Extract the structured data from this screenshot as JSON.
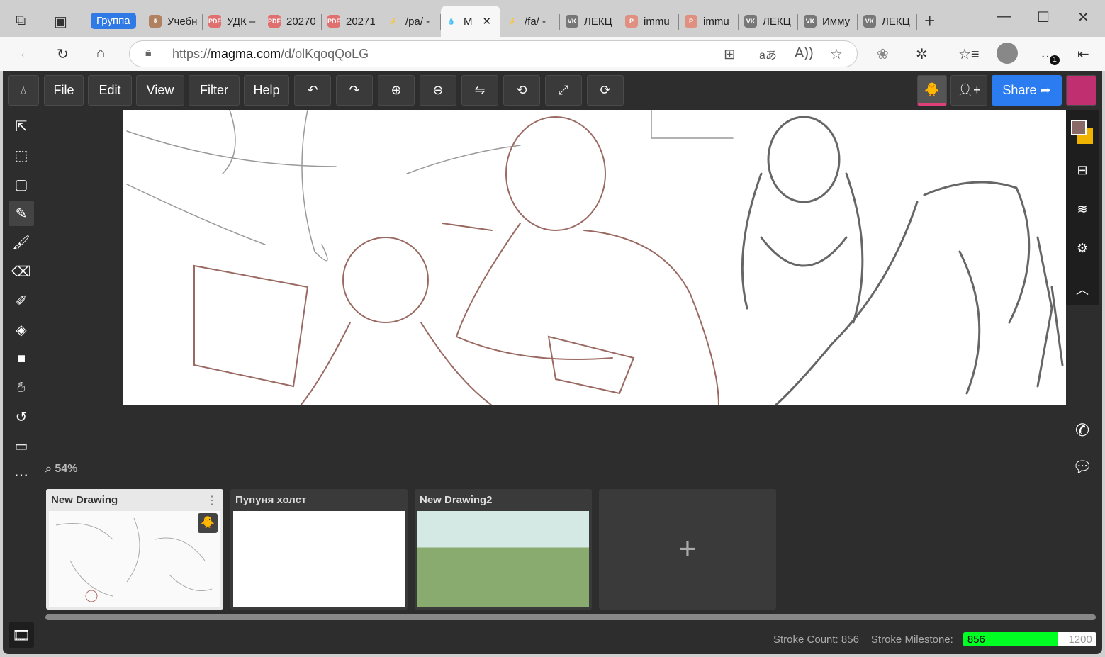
{
  "browser": {
    "group_label": "Группа",
    "tabs": [
      {
        "label": "Учебн",
        "icon": "book-icon"
      },
      {
        "label": "УДК –",
        "icon": "pdf-icon"
      },
      {
        "label": "20270",
        "icon": "pdf-icon"
      },
      {
        "label": "20271",
        "icon": "pdf-icon"
      },
      {
        "label": "/pa/ -",
        "icon": "lightning-icon"
      },
      {
        "label": "M",
        "icon": "magma-icon",
        "active": true
      },
      {
        "label": "/fa/ -",
        "icon": "lightning-icon"
      },
      {
        "label": "ЛЕКЦ",
        "icon": "vk-icon"
      },
      {
        "label": "immu",
        "icon": "powerpoint-icon"
      },
      {
        "label": "immu",
        "icon": "powerpoint-icon"
      },
      {
        "label": "ЛЕКЦ",
        "icon": "vk-icon"
      },
      {
        "label": "Имму",
        "icon": "vk-icon"
      },
      {
        "label": "ЛЕКЦ",
        "icon": "vk-icon"
      }
    ],
    "url_prefix": "https://",
    "url_host": "magma.com",
    "url_path": "/d/olKqoqQoLG",
    "notification_badge": "1"
  },
  "menu": {
    "file": "File",
    "edit": "Edit",
    "view": "View",
    "filter": "Filter",
    "help": "Help",
    "share": "Share"
  },
  "zoom_level": "54%",
  "drawings": [
    {
      "title": "New Drawing"
    },
    {
      "title": "Пупуня холст"
    },
    {
      "title": "New Drawing2"
    }
  ],
  "add_drawing": "+",
  "status": {
    "stroke_count_label": "Stroke Count: 856",
    "milestone_label": "Stroke Milestone:",
    "current": "856",
    "target": "1200",
    "progress": 0.713
  },
  "colors": {
    "primary": "#8a6a66",
    "secondary": "#f0b400",
    "progress": "#00ff22"
  }
}
